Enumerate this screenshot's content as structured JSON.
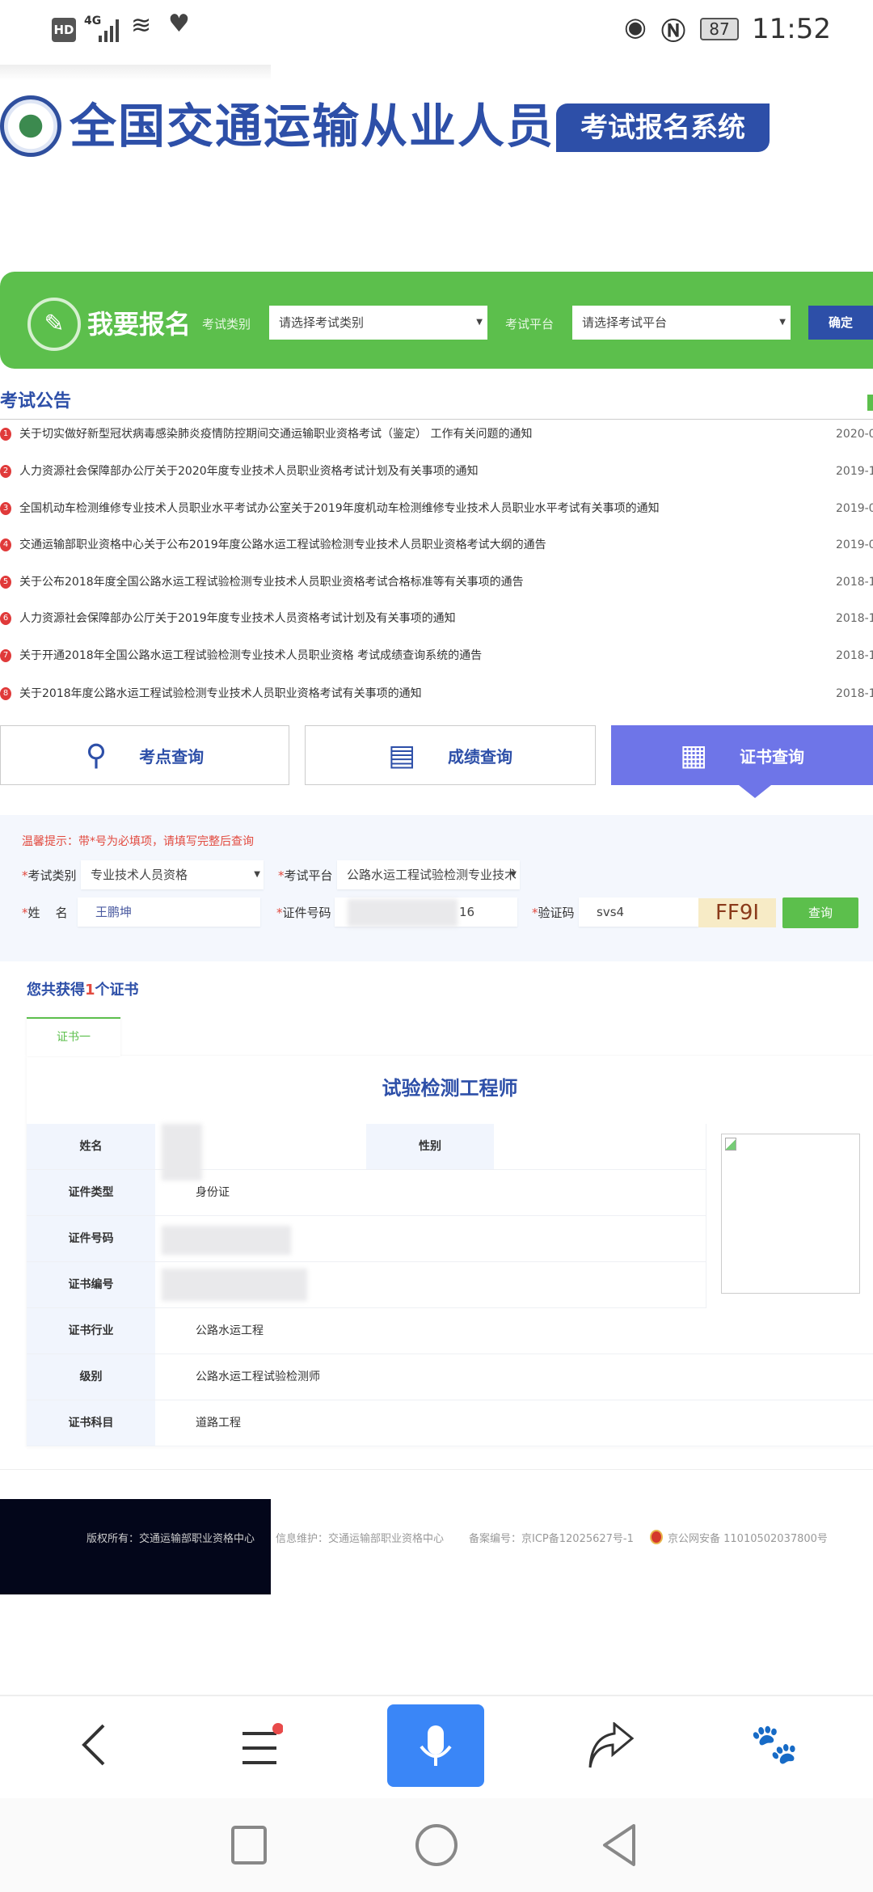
{
  "status_bar": {
    "network": "4G",
    "battery": "87",
    "time": "11:52"
  },
  "header": {
    "title": "全国交通运输从业人员",
    "subtitle": "考试报名系统"
  },
  "signup": {
    "title": "我要报名",
    "category_label": "考试类别",
    "category_placeholder": "请选择考试类别",
    "platform_label": "考试平台",
    "platform_placeholder": "请选择考试平台",
    "confirm": "确定"
  },
  "notices": {
    "heading": "考试公告",
    "items": [
      {
        "num": "1",
        "title": "关于切实做好新型冠状病毒感染肺炎疫情防控期间交通运输职业资格考试（鉴定） 工作有关问题的通知",
        "date": "2020-0"
      },
      {
        "num": "2",
        "title": "人力资源社会保障部办公厅关于2020年度专业技术人员职业资格考试计划及有关事项的通知",
        "date": "2019-1"
      },
      {
        "num": "3",
        "title": "全国机动车检测维修专业技术人员职业水平考试办公室关于2019年度机动车检测维修专业技术人员职业水平考试有关事项的通知",
        "date": "2019-0"
      },
      {
        "num": "4",
        "title": "交通运输部职业资格中心关于公布2019年度公路水运工程试验检测专业技术人员职业资格考试大纲的通告",
        "date": "2019-0"
      },
      {
        "num": "5",
        "title": "关于公布2018年度全国公路水运工程试验检测专业技术人员职业资格考试合格标准等有关事项的通告",
        "date": "2018-1"
      },
      {
        "num": "6",
        "title": "人力资源社会保障部办公厅关于2019年度专业技术人员资格考试计划及有关事项的通知",
        "date": "2018-1"
      },
      {
        "num": "7",
        "title": "关于开通2018年全国公路水运工程试验检测专业技术人员职业资格 考试成绩查询系统的通告",
        "date": "2018-1"
      },
      {
        "num": "8",
        "title": "关于2018年度公路水运工程试验检测专业技术人员职业资格考试有关事项的通知",
        "date": "2018-1"
      }
    ]
  },
  "query_tabs": [
    {
      "label": "考点查询",
      "icon": "map-pin-icon"
    },
    {
      "label": "成绩查询",
      "icon": "score-sheet-icon"
    },
    {
      "label": "证书查询",
      "icon": "certificate-icon",
      "active": true
    }
  ],
  "query_form": {
    "hint": "温馨提示：带*号为必填项，请填写完整后查询",
    "req": "*",
    "category_label": "考试类别",
    "category_value": "专业技术人员资格",
    "platform_label": "考试平台",
    "platform_value": "公路水运工程试验检测专业技术",
    "name_label": "姓    名",
    "name_value": "王鹏坤",
    "id_label": "证件号码",
    "id_value_visible": "16",
    "captcha_label": "验证码",
    "captcha_value": "svs4",
    "captcha_image": "FF9I",
    "submit": "查询"
  },
  "result": {
    "prefix": "您共获得",
    "count": "1",
    "suffix": "个证书",
    "tab": "证书一",
    "cert_title": "试验检测工程师",
    "labels": {
      "name": "姓名",
      "gender": "性别",
      "id_type": "证件类型",
      "id_no": "证件号码",
      "cert_no": "证书编号",
      "industry": "证书行业",
      "level": "级别",
      "subject": "证书科目"
    },
    "values": {
      "id_type": "身份证",
      "industry": "公路水运工程",
      "level": "公路水运工程试验检测师",
      "subject": "道路工程"
    }
  },
  "footer": {
    "copyright": "版权所有：交通运输部职业资格中心",
    "maintain": "信息维护：交通运输部职业资格中心",
    "icp": "备案编号：京ICP备12025627号-1",
    "police": "京公网安备 11010502037800号"
  },
  "browser_nav": [
    "back-icon",
    "menu-icon",
    "microphone-icon",
    "share-icon",
    "baidu-icon"
  ],
  "colors": {
    "green": "#5cbf4c",
    "blue": "#2d4fa8",
    "active_tab": "#6e75e8",
    "mic": "#3a86f7",
    "alert": "#e24a3f"
  }
}
